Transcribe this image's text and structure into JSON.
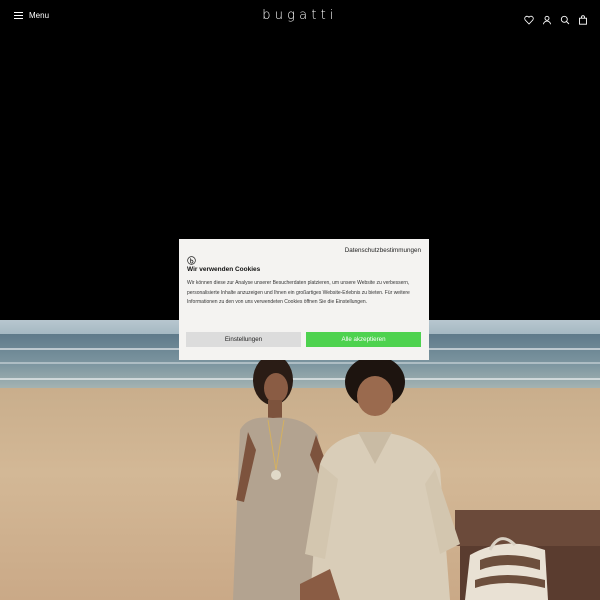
{
  "header": {
    "menu_label": "Menu",
    "logo_text": "bugatti",
    "icons": [
      "heart-icon",
      "user-icon",
      "search-icon",
      "bag-icon"
    ]
  },
  "cookie_modal": {
    "privacy_link": "Datenschutzbestimmungen",
    "title": "Wir verwenden Cookies",
    "body": "Wir können diese zur Analyse unserer Besucherdaten platzieren, um unsere Website zu verbessern, personalisierte Inhalte anzuzeigen und Ihnen ein großartiges Website-Erlebnis zu bieten. Für weitere Informationen zu den von uns verwendeten Cookies öffnen Sie die Einstellungen.",
    "settings_button": "Einstellungen",
    "accept_button": "Alle akzeptieren"
  },
  "colors": {
    "page_background": "#000000",
    "accept_button": "#4ed24f",
    "settings_button": "#dcdcdc",
    "modal_background": "#f4f3f1"
  }
}
